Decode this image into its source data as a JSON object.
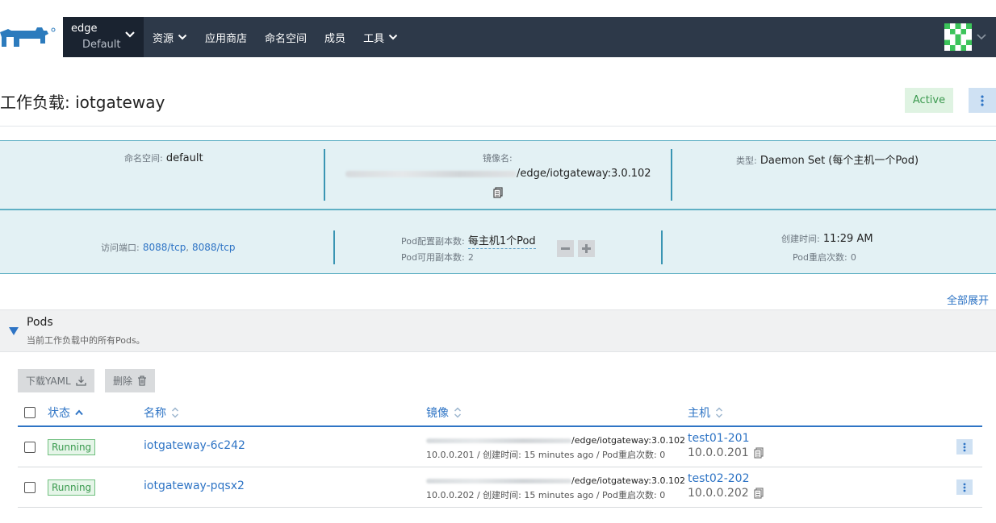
{
  "header": {
    "cluster_name": "edge",
    "project_name": "Default",
    "nav": [
      {
        "label": "资源",
        "has_dropdown": true
      },
      {
        "label": "应用商店",
        "has_dropdown": false
      },
      {
        "label": "命名空间",
        "has_dropdown": false
      },
      {
        "label": "成员",
        "has_dropdown": false
      },
      {
        "label": "工具",
        "has_dropdown": true
      }
    ]
  },
  "page": {
    "title_prefix": "工作负载:",
    "workload_name": "iotgateway",
    "state": "Active"
  },
  "info": {
    "namespace_label": "命名空间:",
    "namespace_value": "default",
    "image_label": "镜像名:",
    "image_value": "/edge/iotgateway:3.0.102",
    "type_label": "类型:",
    "type_value": "Daemon Set (每个主机一个Pod)",
    "ports_label": "访问端口:",
    "ports": [
      "8088/tcp",
      "8088/tcp"
    ],
    "port_sep": ",",
    "scale_label": "Pod配置副本数:",
    "scale_value": "每主机1个Pod",
    "available_label": "Pod可用副本数:",
    "available_value": "2",
    "created_label": "创建时间:",
    "created_value": "11:29 AM",
    "restarts_label": "Pod重启次数:",
    "restarts_value": "0"
  },
  "expand_all": "全部展开",
  "pods_section": {
    "title": "Pods",
    "subtitle": "当前工作负载中的所有Pods。",
    "download_yaml": "下载YAML",
    "delete": "删除",
    "columns": {
      "state": "状态",
      "name": "名称",
      "image": "镜像",
      "host": "主机"
    },
    "rows": [
      {
        "state": "Running",
        "name": "iotgateway-6c242",
        "image": "/edge/iotgateway:3.0.102",
        "detail": "10.0.0.201 / 创建时间: 15 minutes ago / Pod重启次数: 0",
        "host": "test01-201",
        "host_ip": "10.0.0.201"
      },
      {
        "state": "Running",
        "name": "iotgateway-pqsx2",
        "image": "/edge/iotgateway:3.0.102",
        "detail": "10.0.0.202 / 创建时间: 15 minutes ago / Pod重启次数: 0",
        "host": "test02-202",
        "host_ip": "10.0.0.202"
      }
    ]
  },
  "colors": {
    "topbar": "#2d3949",
    "accent": "#2e74c5",
    "info_bg": "#e3f1f4",
    "active_bg": "#dff3e2",
    "running_green": "#3a9a4e"
  }
}
